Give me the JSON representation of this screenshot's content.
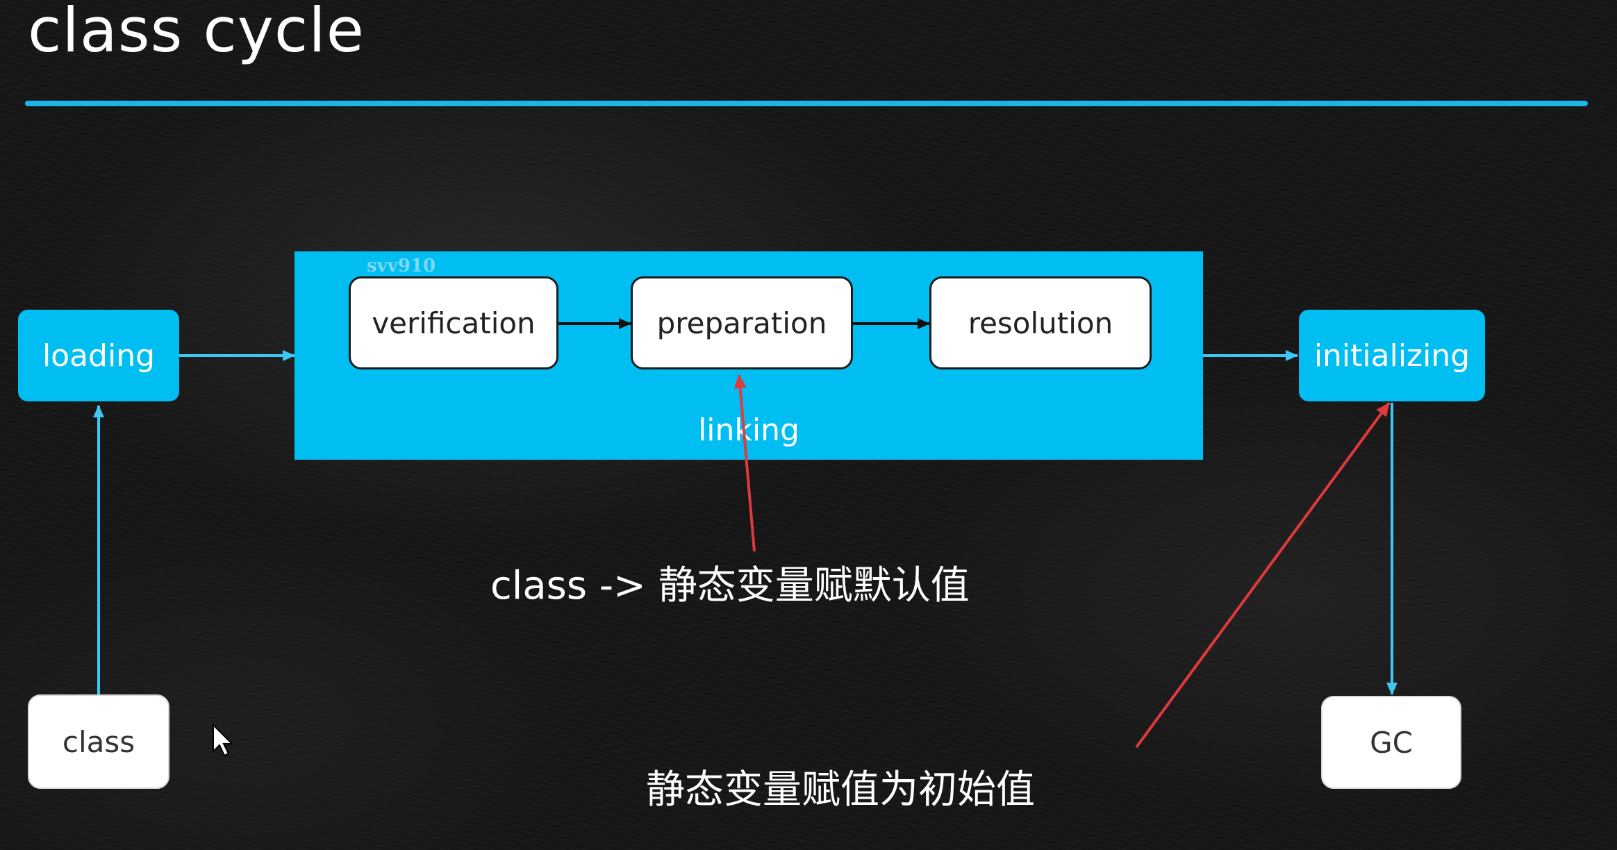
{
  "title": "class cycle",
  "stages": {
    "loading": "loading",
    "linking": "linking",
    "verification": "verification",
    "preparation": "preparation",
    "resolution": "resolution",
    "initializing": "initializing",
    "class": "class",
    "gc": "GC"
  },
  "annotations": {
    "preparation_note": "class -> 静态变量赋默认值",
    "initializing_note": "静态变量赋值为初始值"
  },
  "watermark": "svv910",
  "colors": {
    "accent": "#00bef2",
    "annotation_arrow": "#e0393e",
    "background": "#161616"
  }
}
